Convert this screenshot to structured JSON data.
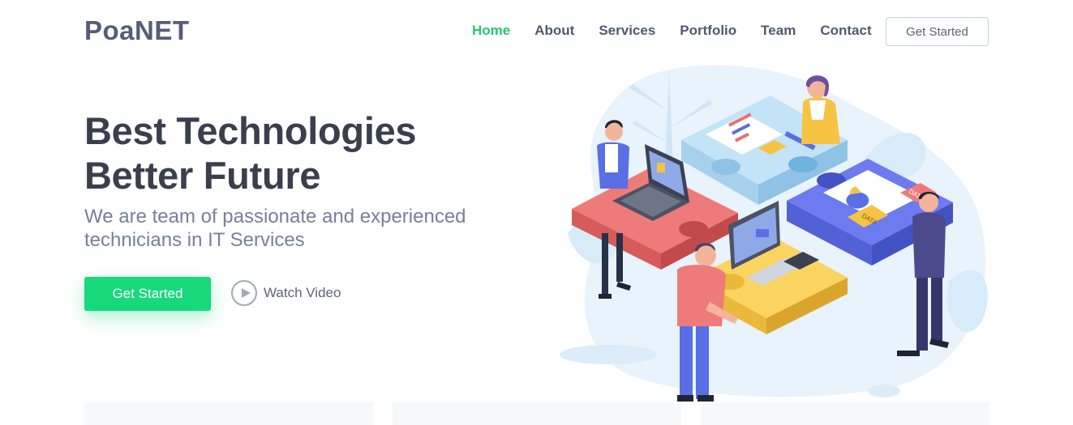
{
  "header": {
    "logo": "PoaNET",
    "nav": [
      "Home",
      "About",
      "Services",
      "Portfolio",
      "Team",
      "Contact"
    ],
    "active_nav": "Home",
    "cta_label": "Get Started"
  },
  "hero": {
    "title_line1": "Best Technologies",
    "title_line2": "Better Future",
    "subtitle": "We are team of passionate and experienced technicians in IT Services",
    "cta_label": "Get Started",
    "watch_label": "Watch Video",
    "illustration": {
      "tag_left": "DATA",
      "tag_right": "DATA"
    }
  },
  "colors": {
    "accent": "#17d97b",
    "nav_active": "#20c870",
    "text_dark": "#393f4c",
    "text_muted": "#75819a"
  },
  "icons": [
    "play-icon"
  ]
}
